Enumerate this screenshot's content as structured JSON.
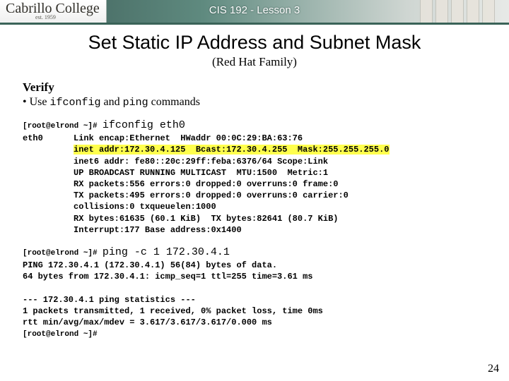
{
  "banner": {
    "logo_main": "Cabrillo College",
    "logo_sub": "est. 1959",
    "lesson_label": "CIS 192 - Lesson 3"
  },
  "headings": {
    "title": "Set Static IP Address and Subnet Mask",
    "subtitle": "(Red Hat Family)",
    "verify": "Verify",
    "bullet_prefix": "• Use ",
    "bullet_cmd1": "ifconfig",
    "bullet_mid": " and ",
    "bullet_cmd2": "ping",
    "bullet_suffix": " commands"
  },
  "ifconfig_block": {
    "prompt": "[root@elrond ~]#",
    "command": "ifconfig eth0",
    "iface": "eth0",
    "l1": "Link encap:Ethernet  HWaddr 00:0C:29:BA:63:76",
    "l2": "inet addr:172.30.4.125  Bcast:172.30.4.255  Mask:255.255.255.0",
    "l3": "inet6 addr: fe80::20c:29ff:feba:6376/64 Scope:Link",
    "l4": "UP BROADCAST RUNNING MULTICAST  MTU:1500  Metric:1",
    "l5": "RX packets:556 errors:0 dropped:0 overruns:0 frame:0",
    "l6": "TX packets:495 errors:0 dropped:0 overruns:0 carrier:0",
    "l7": "collisions:0 txqueuelen:1000",
    "l8": "RX bytes:61635 (60.1 KiB)  TX bytes:82641 (80.7 KiB)",
    "l9": "Interrupt:177 Base address:0x1400"
  },
  "ping_block": {
    "prompt": "[root@elrond ~]#",
    "command": "ping -c 1 172.30.4.1",
    "p1": "PING 172.30.4.1 (172.30.4.1) 56(84) bytes of data.",
    "p2": "64 bytes from 172.30.4.1: icmp_seq=1 ttl=255 time=3.61 ms",
    "p3": "--- 172.30.4.1 ping statistics ---",
    "p4": "1 packets transmitted, 1 received, 0% packet loss, time 0ms",
    "p5": "rtt min/avg/max/mdev = 3.617/3.617/3.617/0.000 ms",
    "end_prompt": "[root@elrond ~]#"
  },
  "page_number": "24"
}
